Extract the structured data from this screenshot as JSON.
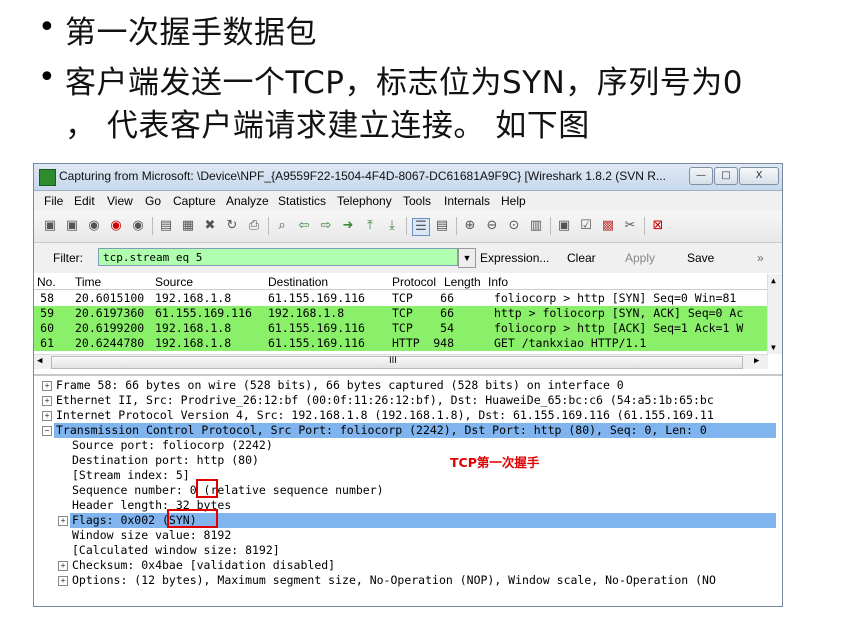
{
  "slide": {
    "bullet1": "第一次握手数据包",
    "bullet2_line1": "客户端发送一个TCP，标志位为SYN，序列号为0",
    "bullet2_line2": "， 代表客户端请求建立连接。 如下图",
    "bullet_glyph": "•"
  },
  "window": {
    "title": "Capturing from Microsoft: \\Device\\NPF_{A9559F22-1504-4F4D-8067-DC61681A9F9C}   [Wireshark 1.8.2  (SVN R...",
    "minimize": "—",
    "maximize": "□",
    "close": "X"
  },
  "menu": [
    "File",
    "Edit",
    "View",
    "Go",
    "Capture",
    "Analyze",
    "Statistics",
    "Telephony",
    "Tools",
    "Internals",
    "Help"
  ],
  "filter": {
    "label": "Filter:",
    "value": "tcp.stream eq 5",
    "expression": "Expression...",
    "clear": "Clear",
    "apply": "Apply",
    "save": "Save",
    "more": "»"
  },
  "packet_list": {
    "columns": [
      "No.",
      "Time",
      "Source",
      "Destination",
      "Protocol",
      "Length",
      "Info"
    ],
    "rows": [
      {
        "no": "58",
        "time": "20.6015100",
        "src": "192.168.1.8",
        "dst": "61.155.169.116",
        "proto": "TCP",
        "len": "66",
        "info": "foliocorp > http [SYN] Seq=0 Win=81",
        "color": "#ffffff"
      },
      {
        "no": "59",
        "time": "20.6197360",
        "src": "61.155.169.116",
        "dst": "192.168.1.8",
        "proto": "TCP",
        "len": "66",
        "info": "http > foliocorp [SYN, ACK] Seq=0 Ac",
        "color": "#8af06a"
      },
      {
        "no": "60",
        "time": "20.6199200",
        "src": "192.168.1.8",
        "dst": "61.155.169.116",
        "proto": "TCP",
        "len": "54",
        "info": "foliocorp > http [ACK] Seq=1 Ack=1 W",
        "color": "#8af06a"
      },
      {
        "no": "61",
        "time": "20.6244780",
        "src": "192.168.1.8",
        "dst": "61.155.169.116",
        "proto": "HTTP",
        "len": "948",
        "info": "GET /tankxiao HTTP/1.1",
        "color": "#8af06a"
      }
    ],
    "hscroll_grip": "III"
  },
  "details": [
    {
      "text": "Frame 58: 66 bytes on wire (528 bits), 66 bytes captured (528 bits) on interface 0",
      "indent": 0,
      "expander": "+",
      "selected": false
    },
    {
      "text": "Ethernet II, Src: Prodrive_26:12:bf (00:0f:11:26:12:bf), Dst: HuaweiDe_65:bc:c6 (54:a5:1b:65:bc",
      "indent": 0,
      "expander": "+",
      "selected": false
    },
    {
      "text": "Internet Protocol Version 4, Src: 192.168.1.8 (192.168.1.8), Dst: 61.155.169.116 (61.155.169.11",
      "indent": 0,
      "expander": "+",
      "selected": false
    },
    {
      "text": "Transmission Control Protocol, Src Port: foliocorp (2242), Dst Port: http (80), Seq: 0, Len: 0",
      "indent": 0,
      "expander": "−",
      "selected": true
    },
    {
      "text": "Source port: foliocorp (2242)",
      "indent": 1,
      "expander": "",
      "selected": false
    },
    {
      "text": "Destination port: http (80)",
      "indent": 1,
      "expander": "",
      "selected": false
    },
    {
      "text": "[Stream index: 5]",
      "indent": 1,
      "expander": "",
      "selected": false
    },
    {
      "text": "Sequence number: 0    (relative sequence number)",
      "indent": 1,
      "expander": "",
      "selected": false
    },
    {
      "text": "Header length: 32 bytes",
      "indent": 1,
      "expander": "",
      "selected": false
    },
    {
      "text": "Flags: 0x002 (SYN)",
      "indent": 1,
      "expander": "+",
      "selected": true
    },
    {
      "text": "Window size value: 8192",
      "indent": 1,
      "expander": "",
      "selected": false
    },
    {
      "text": "[Calculated window size: 8192]",
      "indent": 1,
      "expander": "",
      "selected": false
    },
    {
      "text": "Checksum: 0x4bae [validation disabled]",
      "indent": 1,
      "expander": "+",
      "selected": false
    },
    {
      "text": "Options: (12 bytes), Maximum segment size, No-Operation (NOP), Window scale, No-Operation (NO",
      "indent": 1,
      "expander": "+",
      "selected": false
    }
  ],
  "annotation": "TCP第一次握手",
  "colors": {
    "filter_bg": "#afffaf",
    "selection": "#80b4ee",
    "annotation": "#e00000",
    "green_row": "#8af06a"
  }
}
